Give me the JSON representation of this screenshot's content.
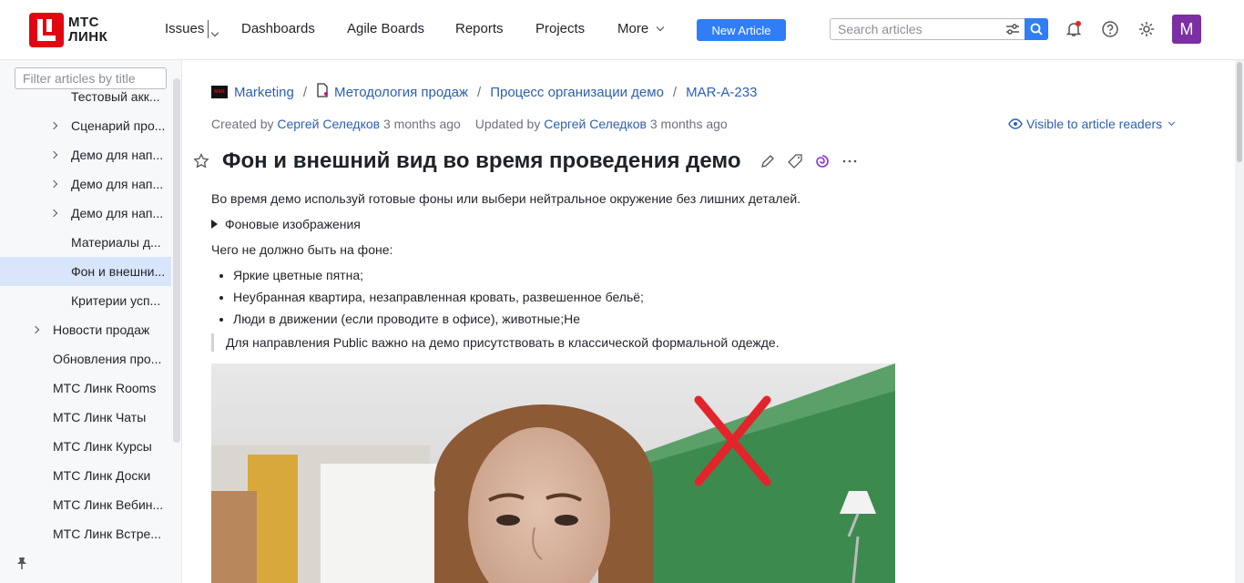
{
  "brand": {
    "name_line1": "МТС",
    "name_line2": "ЛИНК"
  },
  "nav": {
    "issues": "Issues",
    "dashboards": "Dashboards",
    "agile_boards": "Agile Boards",
    "reports": "Reports",
    "projects": "Projects",
    "more": "More",
    "new_article": "New Article"
  },
  "search": {
    "placeholder": "Search articles"
  },
  "user": {
    "avatar_letter": "M"
  },
  "sidebar": {
    "filter_placeholder": "Filter articles by title",
    "items": [
      {
        "label": "Тестовый акк...",
        "level": 2,
        "expandable": false
      },
      {
        "label": "Сценарий про...",
        "level": 2,
        "expandable": true
      },
      {
        "label": "Демо для нап...",
        "level": 2,
        "expandable": true
      },
      {
        "label": "Демо для нап...",
        "level": 2,
        "expandable": true
      },
      {
        "label": "Демо для нап...",
        "level": 2,
        "expandable": true
      },
      {
        "label": "Материалы д...",
        "level": 2,
        "expandable": false
      },
      {
        "label": "Фон и внешни...",
        "level": 2,
        "expandable": false,
        "selected": true
      },
      {
        "label": "Критерии усп...",
        "level": 2,
        "expandable": false
      },
      {
        "label": "Новости продаж",
        "level": 1,
        "expandable": true
      },
      {
        "label": "Обновления про...",
        "level": 1,
        "expandable": false
      },
      {
        "label": "МТС Линк Rooms",
        "level": 1,
        "expandable": false
      },
      {
        "label": "МТС Линк Чаты",
        "level": 1,
        "expandable": false
      },
      {
        "label": "МТС Линк Курсы",
        "level": 1,
        "expandable": false
      },
      {
        "label": "МТС Линк Доски",
        "level": 1,
        "expandable": false
      },
      {
        "label": "МТС Линк Вебин...",
        "level": 1,
        "expandable": false
      },
      {
        "label": "МТС Линк Встре...",
        "level": 1,
        "expandable": false
      }
    ]
  },
  "breadcrumb": {
    "project": "Marketing",
    "project_icon_text": "MAR",
    "level1": "Методология продаж",
    "level2": "Процесс организации демо",
    "article_id": "MAR-A-233"
  },
  "meta": {
    "created_prefix": "Created by",
    "created_by": "Сергей Селедков",
    "created_when": "3 months ago",
    "updated_prefix": "Updated by",
    "updated_by": "Сергей Селедков",
    "updated_when": "3 months ago",
    "visibility": "Visible to article readers"
  },
  "article": {
    "title": "Фон и внешний вид во время проведения демо",
    "intro": "Во время демо используй готовые фоны или выбери нейтральное окружение без лишних деталей.",
    "details_summary": "Фоновые изображения",
    "not_allowed_heading": "Чего не должно быть на фоне:",
    "bullets": [
      "Яркие цветные пятна;",
      "Неубранная квартира, незаправленная кровать, развешенное бельё;",
      "Люди в движении (если проводите в офисе), животные;Не"
    ],
    "quote": "Для направления Public важно на демо присутствовать в классической формальной одежде."
  },
  "colors": {
    "accent": "#2f7ef5",
    "link": "#2b5fb4",
    "selected_row": "#d9e5fb",
    "brand_red": "#e30611",
    "avatar": "#7b2fa3"
  }
}
